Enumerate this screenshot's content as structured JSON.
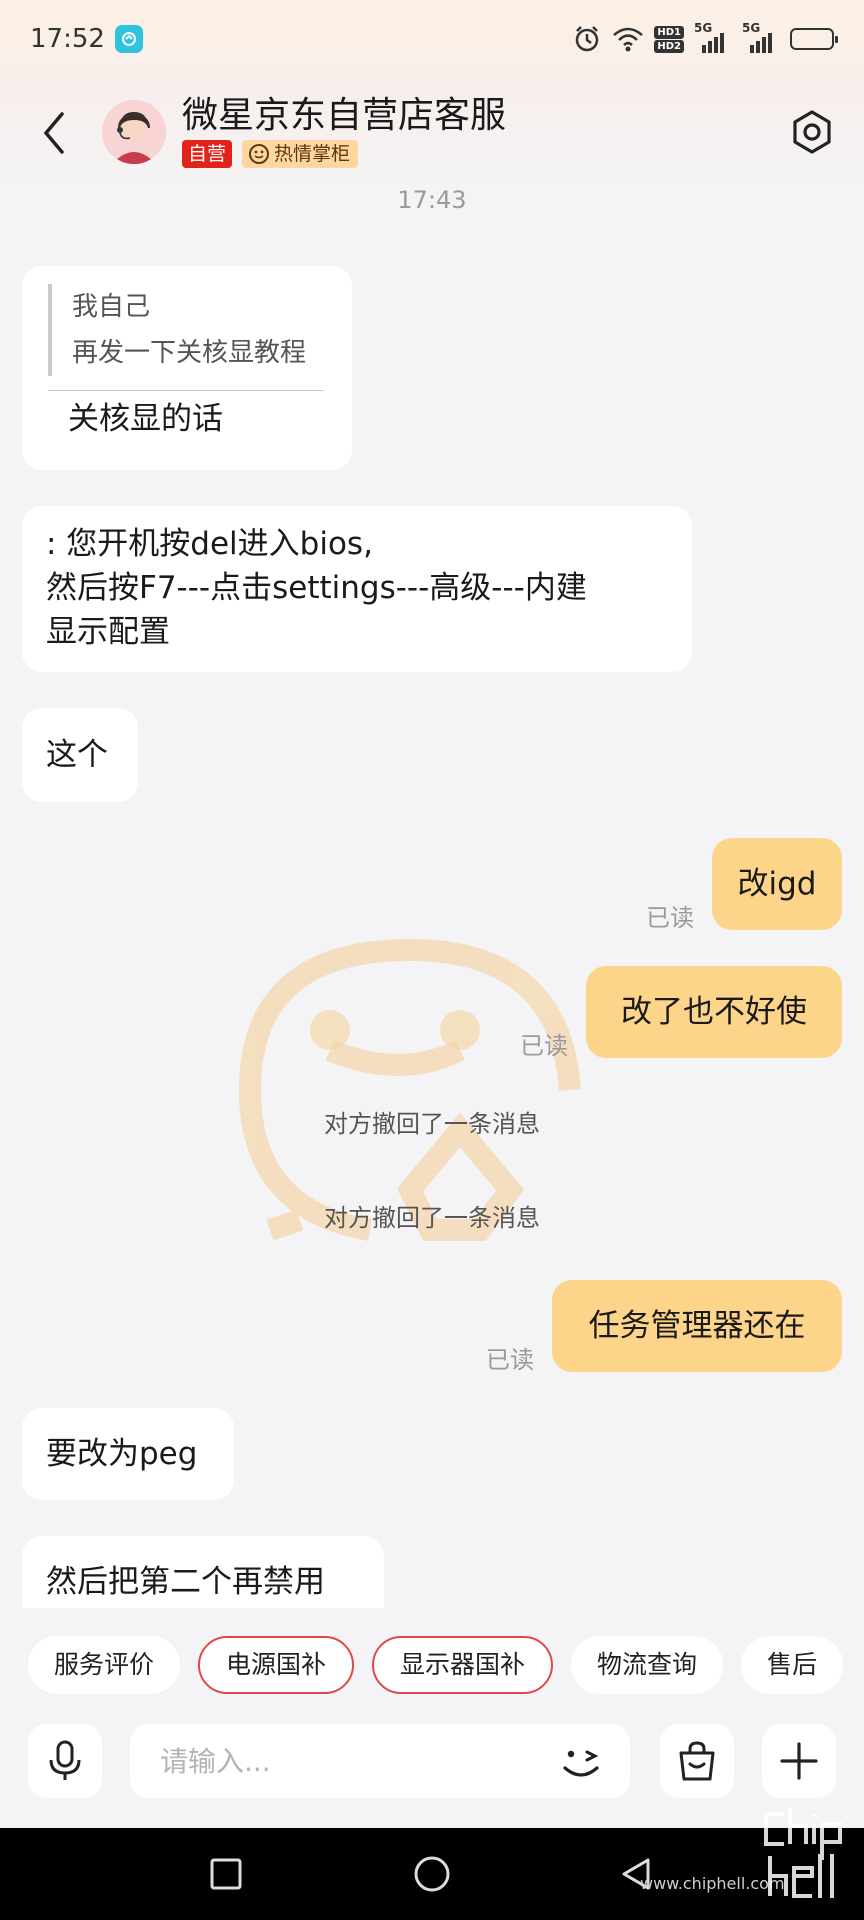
{
  "status_bar": {
    "time": "17:52",
    "net_badge_1": "HD1",
    "net_badge_2": "HD2",
    "sig1_label": "5G",
    "sig2_label": "5G",
    "icons": [
      "alarm-icon",
      "wifi-icon",
      "signal-icon",
      "battery-icon"
    ]
  },
  "header": {
    "title": "微星京东自营店客服",
    "badge_self": "自营",
    "badge_hot": "热情掌柜"
  },
  "timestamp": "17:43",
  "messages": {
    "m1": {
      "quote_author": "我自己",
      "quote_text": "再发一下关核显教程",
      "reply": "关核显的话"
    },
    "m2": {
      "line1": ":  您开机按del进入bios,",
      "line2": "然后按F7---点击settings---高级---内建",
      "line3": "显示配置"
    },
    "m3": {
      "text": "这个"
    },
    "m4": {
      "text": "改igd",
      "read": "已读"
    },
    "m5": {
      "text": "改了也不好使",
      "read": "已读"
    },
    "recall1": "对方撤回了一条消息",
    "recall2": "对方撤回了一条消息",
    "m6": {
      "text": "任务管理器还在",
      "read": "已读"
    },
    "m7": {
      "text": "要改为peg"
    },
    "m8": {
      "text": "然后把第二个再禁用"
    }
  },
  "quick_replies": [
    "服务评价",
    "电源国补",
    "显示器国补",
    "物流查询",
    "售后"
  ],
  "input": {
    "placeholder": "请输入..."
  },
  "watermark": {
    "site": "www.chiphell.com"
  },
  "colors": {
    "my_bubble": "#fdd58a",
    "badge_self": "#e2231a",
    "badge_hot": "#ffd69e",
    "chip_outline": "#e04848"
  }
}
